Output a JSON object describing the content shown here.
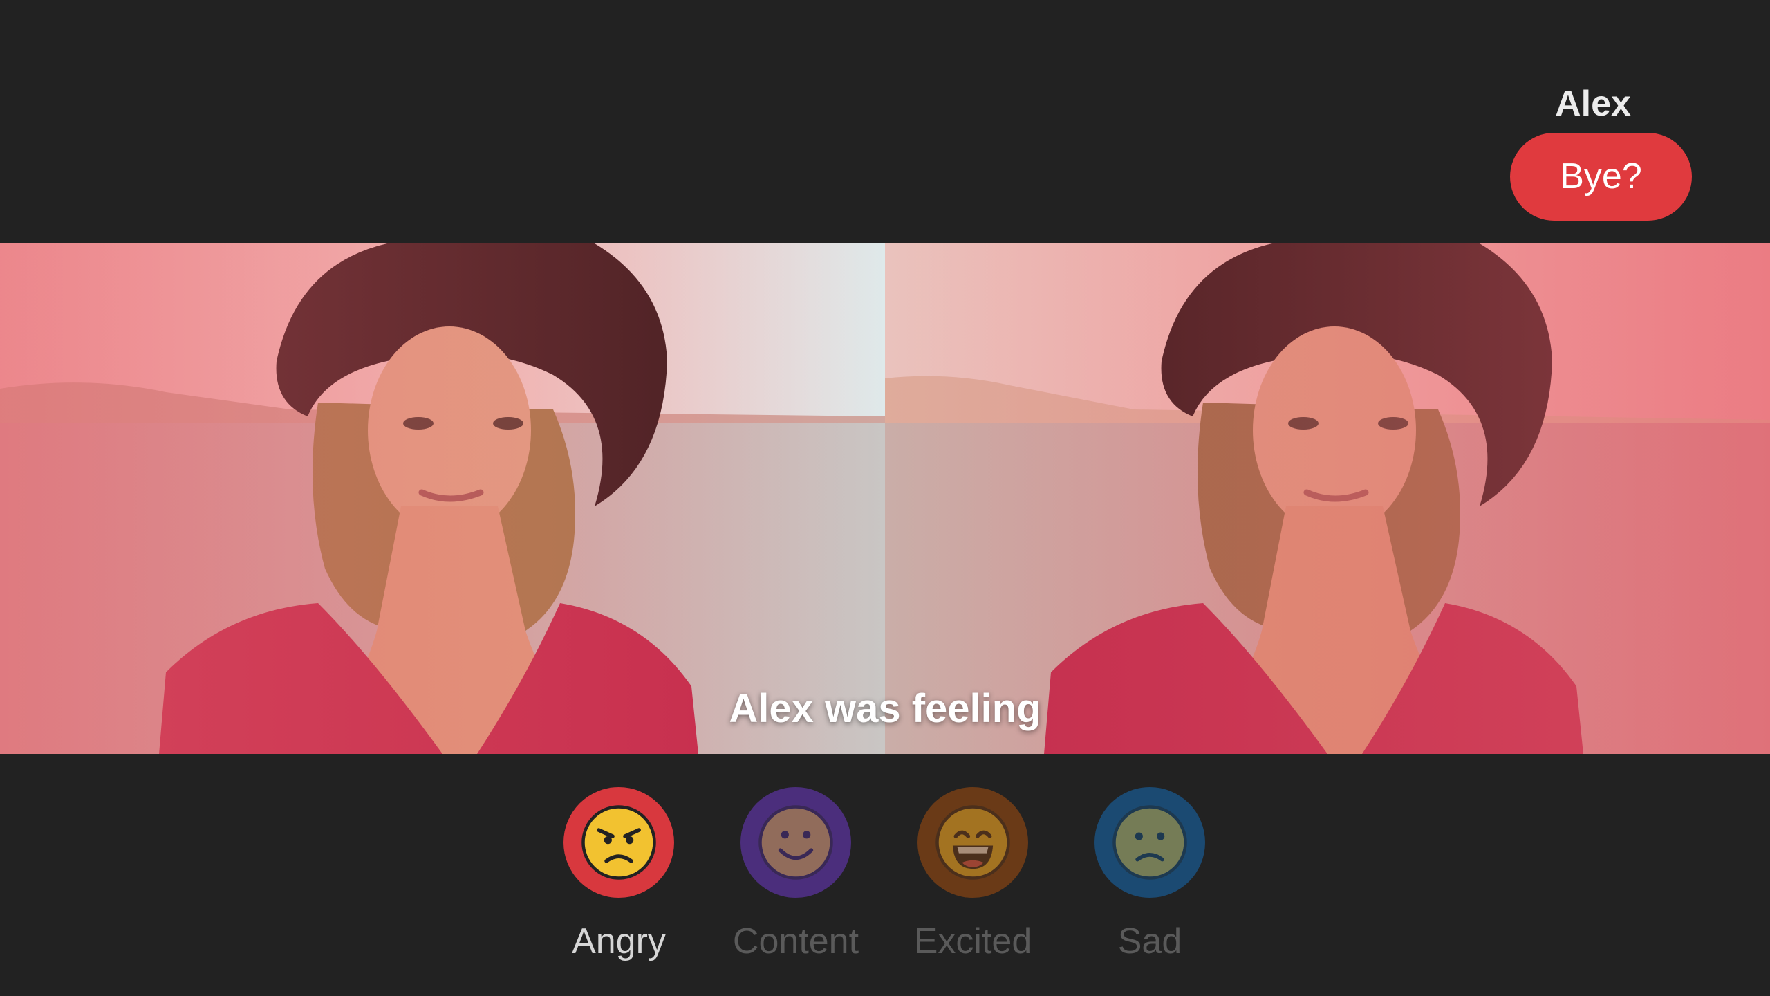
{
  "header": {
    "user_name": "Alex",
    "leave_button_label": "Bye?",
    "leave_button_color": "#e03a3e"
  },
  "stage": {
    "caption": "Alex was feeling",
    "overlay_color": "#e8646e"
  },
  "emotions": [
    {
      "label": "Angry",
      "icon": "angry-face-icon",
      "ring_color": "#d8383e",
      "selected": true
    },
    {
      "label": "Content",
      "icon": "smiling-face-icon",
      "ring_color": "#4b2e7c",
      "selected": false
    },
    {
      "label": "Excited",
      "icon": "grinning-face-icon",
      "ring_color": "#6a3a17",
      "selected": false
    },
    {
      "label": "Sad",
      "icon": "sad-face-icon",
      "ring_color": "#1b4a72",
      "selected": false
    }
  ]
}
